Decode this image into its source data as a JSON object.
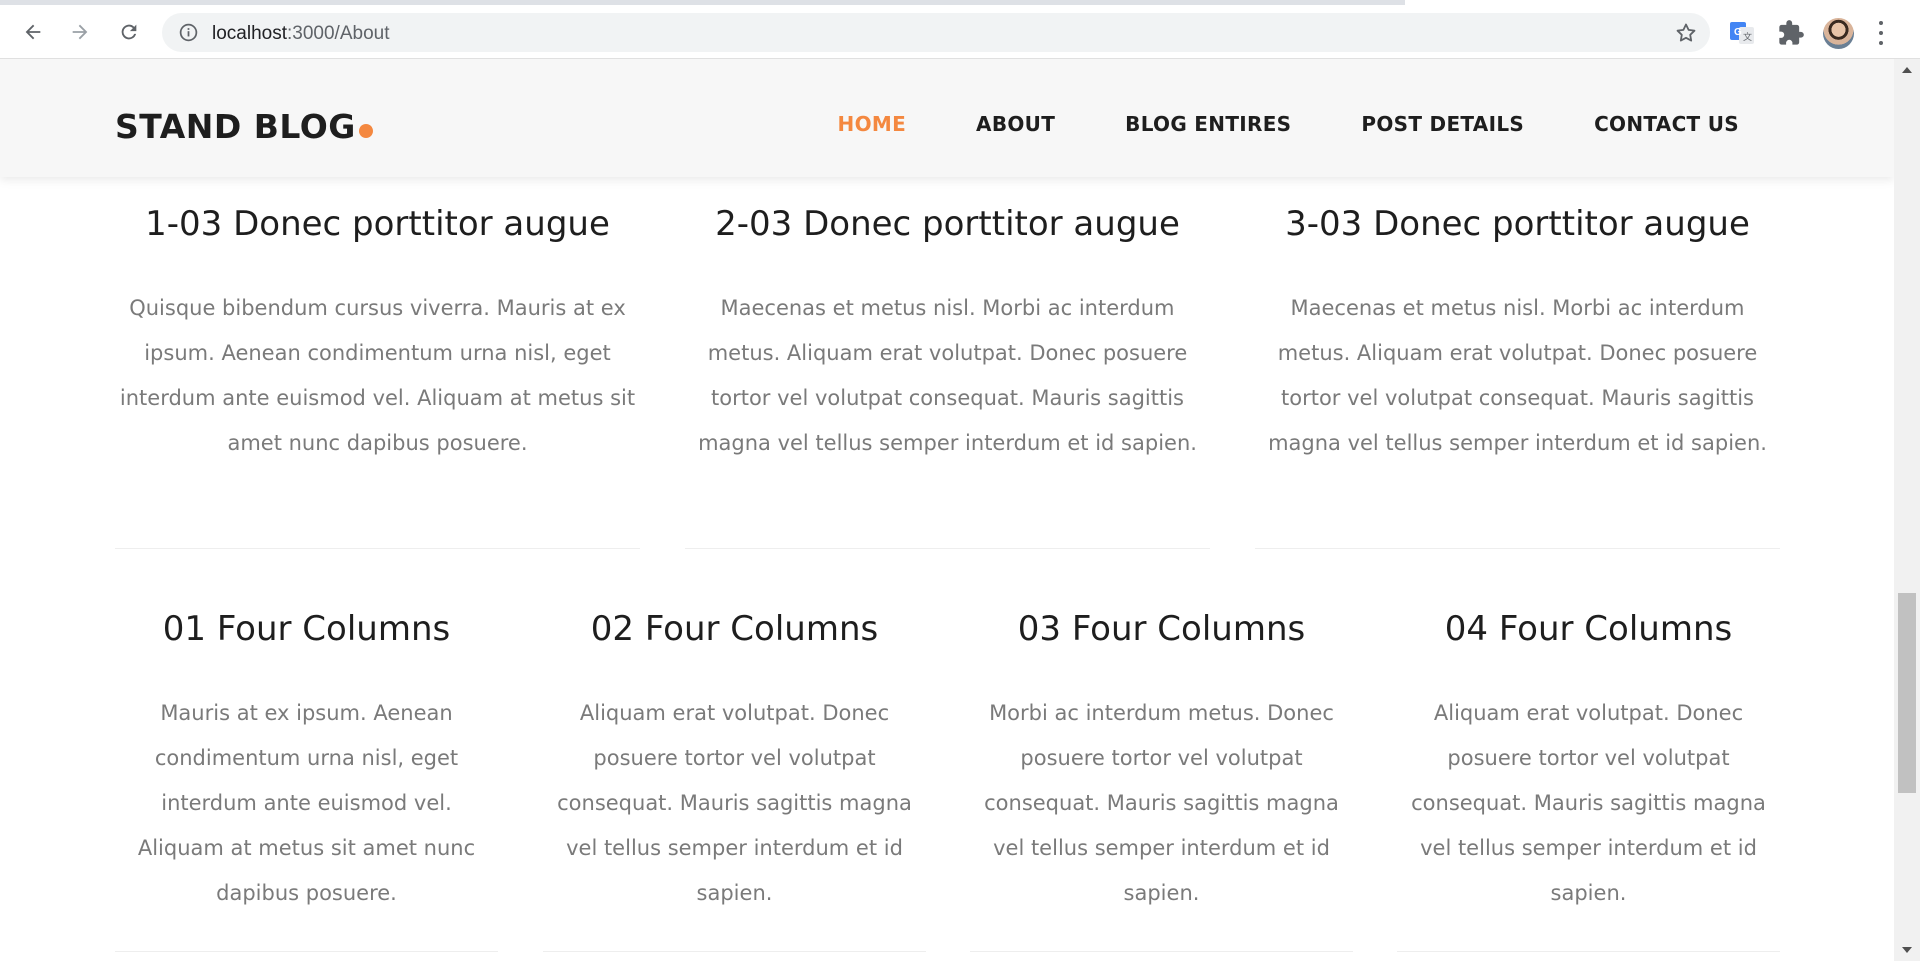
{
  "browser": {
    "url_host": "localhost",
    "url_path": ":3000/About",
    "icons": {
      "back": "arrow-left-icon",
      "forward": "arrow-right-icon",
      "reload": "reload-icon",
      "site_info": "info-icon",
      "bookmark": "star-icon",
      "translate": "google-translate-icon",
      "extensions": "puzzle-icon",
      "profile": "avatar",
      "menu": "kebab-menu-icon"
    }
  },
  "site": {
    "logo_text": "STAND BLOG",
    "accent_color": "#f48840",
    "nav": [
      {
        "label": "HOME",
        "active": true
      },
      {
        "label": "ABOUT",
        "active": false
      },
      {
        "label": "BLOG ENTIRES",
        "active": false
      },
      {
        "label": "POST DETAILS",
        "active": false
      },
      {
        "label": "CONTACT US",
        "active": false
      }
    ]
  },
  "three_columns": [
    {
      "title": "1-03 Donec porttitor augue",
      "text": "Quisque bibendum cursus viverra. Mauris at ex ipsum. Aenean condimentum urna nisl, eget interdum ante euismod vel. Aliquam at metus sit amet nunc dapibus posuere."
    },
    {
      "title": "2-03 Donec porttitor augue",
      "text": "Maecenas et metus nisl. Morbi ac interdum metus. Aliquam erat volutpat. Donec posuere tortor vel volutpat consequat. Mauris sagittis magna vel tellus semper interdum et id sapien."
    },
    {
      "title": "3-03 Donec porttitor augue",
      "text": "Maecenas et metus nisl. Morbi ac interdum metus. Aliquam erat volutpat. Donec posuere tortor vel volutpat consequat. Mauris sagittis magna vel tellus semper interdum et id sapien."
    }
  ],
  "four_columns": [
    {
      "title": "01 Four Columns",
      "text": "Mauris at ex ipsum. Aenean condimentum urna nisl, eget interdum ante euismod vel. Aliquam at metus sit amet nunc dapibus posuere."
    },
    {
      "title": "02 Four Columns",
      "text": "Aliquam erat volutpat. Donec posuere tortor vel volutpat consequat. Mauris sagittis magna vel tellus semper interdum et id sapien."
    },
    {
      "title": "03 Four Columns",
      "text": "Morbi ac interdum metus. Donec posuere tortor vel volutpat consequat. Mauris sagittis magna vel tellus semper interdum et id sapien."
    },
    {
      "title": "04 Four Columns",
      "text": "Aliquam erat volutpat. Donec posuere tortor vel volutpat consequat. Mauris sagittis magna vel tellus semper interdum et id sapien."
    }
  ]
}
